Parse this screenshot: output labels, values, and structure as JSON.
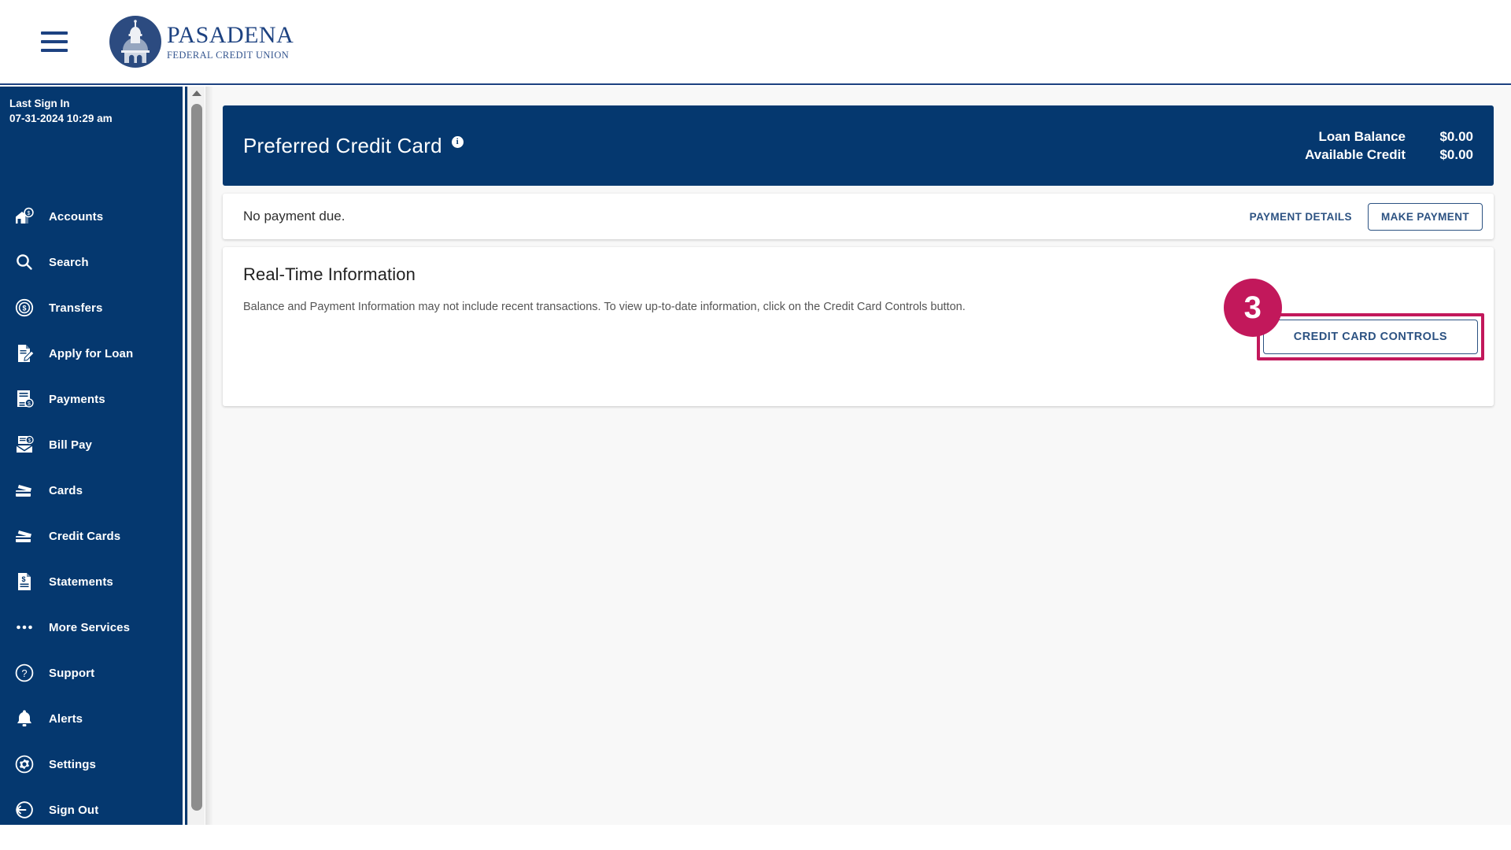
{
  "header": {
    "menu_icon": "hamburger-menu-icon",
    "logo": {
      "name": "PASADENA",
      "tagline": "FEDERAL CREDIT UNION",
      "mark": "dome-building-icon"
    }
  },
  "sidebar": {
    "last_sign_in_label": "Last Sign In",
    "last_sign_in_value": "07-31-2024 10:29 am",
    "items": [
      {
        "label": "Accounts",
        "icon": "house-dollar-icon"
      },
      {
        "label": "Search",
        "icon": "search-icon"
      },
      {
        "label": "Transfers",
        "icon": "transfer-circle-dollar-icon"
      },
      {
        "label": "Apply for Loan",
        "icon": "document-pen-icon"
      },
      {
        "label": "Payments",
        "icon": "invoice-dollar-icon"
      },
      {
        "label": "Bill Pay",
        "icon": "envelope-dollar-icon"
      },
      {
        "label": "Cards",
        "icon": "credit-card-icon"
      },
      {
        "label": "Credit Cards",
        "icon": "credit-card-icon"
      },
      {
        "label": "Statements",
        "icon": "statement-document-icon"
      },
      {
        "label": "More Services",
        "icon": "ellipsis-icon"
      },
      {
        "label": "Support",
        "icon": "question-circle-icon"
      },
      {
        "label": "Alerts",
        "icon": "bell-icon"
      },
      {
        "label": "Settings",
        "icon": "gear-circle-icon"
      },
      {
        "label": "Sign Out",
        "icon": "sign-out-icon"
      }
    ]
  },
  "account": {
    "title": "Preferred Credit Card",
    "info_tooltip_icon": "info-icon",
    "loan_balance_label": "Loan Balance",
    "loan_balance_value": "$0.00",
    "available_credit_label": "Available Credit",
    "available_credit_value": "$0.00"
  },
  "payment_strip": {
    "status_text": "No payment due.",
    "payment_details_label": "PAYMENT DETAILS",
    "make_payment_label": "MAKE PAYMENT"
  },
  "real_time_information": {
    "title": "Real-Time Information",
    "body": "Balance and Payment Information may not include recent transactions. To view up-to-date information, click on the Credit Card Controls button.",
    "credit_card_controls_label": "CREDIT CARD CONTROLS"
  },
  "annotation": {
    "step_number": "3",
    "highlight_color": "#c2185b"
  },
  "colors": {
    "brand_navy": "#05386f",
    "link_blue": "#2c5282",
    "page_bg": "#f8f8f8",
    "accent_pink": "#c2185b"
  }
}
